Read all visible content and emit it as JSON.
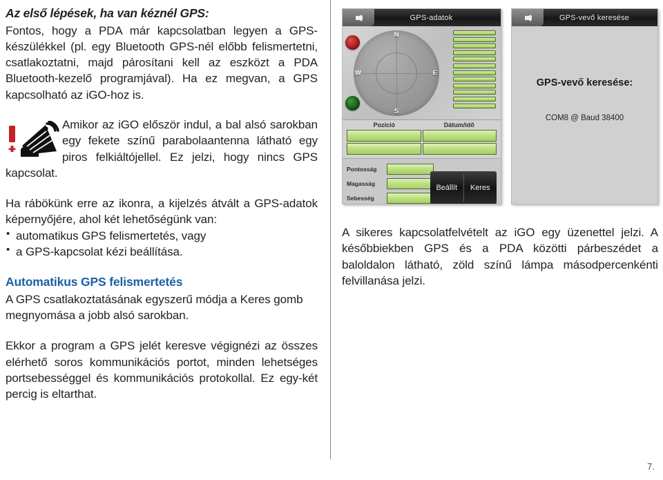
{
  "left_column": {
    "heading": "Az első lépések, ha van kéznél GPS:",
    "intro_paragraph": "Fontos, hogy a PDA már kapcsolatban legyen a GPS-készülékkel (pl. egy Bluetooth GPS-nél előbb felismertetni, csatlakoztatni, majd párosítani kell az eszközt a PDA Bluetooth-kezelő programjával). Ha ez megvan, a GPS kapcsolható az iGO-hoz is.",
    "icon_paragraph": "Amikor az iGO először indul, a bal alsó sarokban egy fekete színű parabolaantenna látható egy piros felkiáltójellel. Ez jelzi, hogy nincs GPS kapcsolat.",
    "options_intro": "Ha rábökünk erre az ikonra, a kijelzés átvált a GPS-adatok képernyőjére, ahol két lehetőségünk van:",
    "bullets": [
      "automatikus GPS felismertetés, vagy",
      "a GPS-kapcsolat kézi beállítása."
    ],
    "sub_heading": "Automatikus GPS felismertetés",
    "sub_paragraph": "A GPS csatlakoztatásának egyszerű módja a Keres gomb megnyomása a jobb alsó sarokban.",
    "final_paragraph": "Ekkor a program a GPS jelét keresve végignézi az összes elérhető soros kommunikációs portot, minden lehetséges portsebességgel és kommunikációs protokollal. Ez egy-két percig is eltarthat."
  },
  "right_column": {
    "paragraph": "A sikeres kapcsolatfelvételt az iGO egy üzenettel jelzi. A későbbiekben GPS és a PDA közötti párbeszédet a baloldalon látható, zöld színű lámpa másodpercenkénti felvillanása jelzi."
  },
  "screenshot_gps_data": {
    "title": "GPS-adatok",
    "back_icon": "back-arrow-icon",
    "compass": {
      "north": "N",
      "east": "E",
      "south": "S",
      "west": "W"
    },
    "indicator_red": "red-status-lamp",
    "indicator_green": "green-status-lamp",
    "satellite_bar_count": 12,
    "grid_headers": [
      "Pozíció",
      "Dátum/idő"
    ],
    "grid_values": [
      "",
      "",
      "",
      ""
    ],
    "stats": [
      {
        "label": "Pontosság",
        "value": ""
      },
      {
        "label": "Magasság",
        "value": ""
      },
      {
        "label": "Sebesség",
        "value": ""
      }
    ],
    "buttons": [
      "Beállít",
      "Keres"
    ]
  },
  "screenshot_gps_search": {
    "title": "GPS-vevő keresése",
    "back_icon": "back-arrow-icon",
    "body_heading": "GPS-vevő keresése:",
    "body_status": "COM8 @ Baud 38400"
  },
  "footer": {
    "page_number": "7."
  },
  "colors": {
    "accent_heading": "#1b5fa8",
    "body_text": "#231f20",
    "divider": "#7e8b96",
    "signal_green": "#a6d264",
    "alert_red": "#c4202a"
  }
}
